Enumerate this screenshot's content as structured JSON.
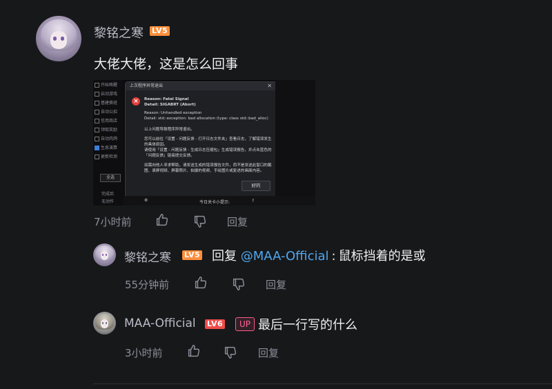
{
  "main_comment": {
    "username": "黎铭之寒",
    "level_badge": "LV5",
    "text": "大佬大佬，这是怎么回事",
    "time": "7小时前",
    "reply_label": "回复",
    "attached_image": {
      "sidebar_items": [
        {
          "label": "开始唤醒",
          "checked": false
        },
        {
          "label": "启动游戏",
          "checked": false
        },
        {
          "label": "基建换班",
          "checked": false
        },
        {
          "label": "自动公招",
          "checked": false
        },
        {
          "label": "信用商店",
          "checked": false
        },
        {
          "label": "领取奖励",
          "checked": false
        },
        {
          "label": "自动肉鸽",
          "checked": false
        },
        {
          "label": "生息演算",
          "checked": true
        },
        {
          "label": "更新检测",
          "checked": false
        }
      ],
      "sidebar_button": "全选",
      "sidebar_bottom_1": "完成后",
      "sidebar_bottom_2": "无动作",
      "dialog": {
        "title": "上次程序异常退出",
        "close": "✕",
        "reason": "Reason: Fatal Signal",
        "detail": "Detail: SIGABRT (Abort)",
        "reason2": "Reason: Unhandled exception",
        "detail2": "Detail: std::exception: bad allocation (type: class std::bad_alloc)",
        "line1": "以上问题导致程序异常退出。",
        "line2": "您可以前往「设置 - 问题反馈 - 打开日志文件夹」查看日志，了解错误发生",
        "line3": "的具体原因。",
        "line4": "请使用「设置 - 问题反馈 - 生成日志压缩包」生成错误报告，并点击蓝色的",
        "line5": "「问题反馈」链接提交反馈。",
        "line6": "如需向他人寻求帮助，请发送生成的错误报告文件，而不是发送此窗口的截",
        "line7": "图、录屏视频、屏幕照片、拍摄的视频、手绘图片或复述的画面内容。",
        "ok_button": "好的"
      },
      "bottom_label_1": "今日关卡小提示:",
      "bottom_label_2": "?"
    }
  },
  "replies": [
    {
      "username": "黎铭之寒",
      "level_badge": "LV5",
      "reply_prefix": "回复",
      "mention": "@MAA-Official",
      "separator": ":",
      "text": "鼠标挡着的是或",
      "time": "55分钟前",
      "reply_label": "回复"
    },
    {
      "username": "MAA-Official",
      "level_badge": "LV6",
      "up_badge": "UP",
      "text": "最后一行写的什么",
      "time": "3小时前",
      "reply_label": "回复"
    }
  ],
  "colors": {
    "background": "#17181a",
    "username": "#b8bcc6",
    "link": "#4fa8f0",
    "meta": "#8b8f99",
    "lv5": "#ff8f3d",
    "lv6": "#f04c49",
    "up": "#ff6699"
  },
  "icons": [
    "like-icon",
    "dislike-icon",
    "error-icon"
  ]
}
